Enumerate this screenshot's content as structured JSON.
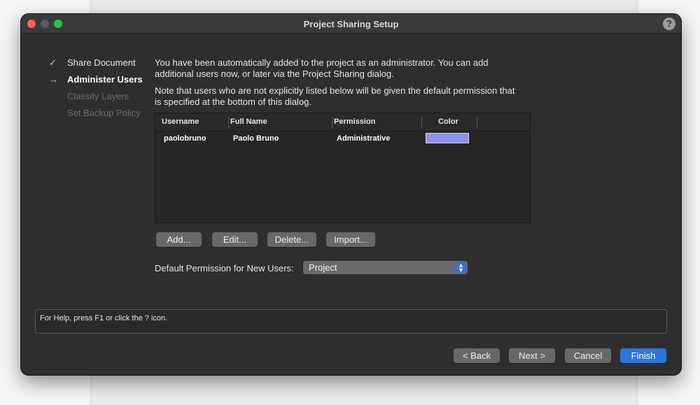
{
  "window": {
    "title": "Project Sharing Setup",
    "help_label": "?"
  },
  "steps": [
    {
      "marker": "✓",
      "label": "Share Document"
    },
    {
      "marker": "→",
      "label": "Administer Users"
    },
    {
      "marker": "",
      "label": "Classify Layers"
    },
    {
      "marker": "",
      "label": "Set Backup Policy"
    }
  ],
  "intro": {
    "line1": "You have been automatically added to the project as an administrator. You can add additional users now, or later via the Project Sharing dialog.",
    "line2": "Note that users who are not explicitly listed below will be given the default permission that is specified at the bottom of this dialog."
  },
  "table": {
    "columns": [
      "Username",
      "Full Name",
      "Permission",
      "Color"
    ],
    "rows": [
      {
        "username": "paolobruno",
        "full_name": "Paolo Bruno",
        "permission": "Administrative",
        "color": "#8e90e6"
      }
    ]
  },
  "buttons": {
    "add": "Add...",
    "edit": "Edit...",
    "delete": "Delete...",
    "import": "Import..."
  },
  "default_permission": {
    "label": "Default Permission for New Users:",
    "value": "Project"
  },
  "help_text": "For Help, press F1 or click the ? icon.",
  "footer": {
    "back": "< Back",
    "next": "Next >",
    "cancel": "Cancel",
    "finish": "Finish"
  }
}
